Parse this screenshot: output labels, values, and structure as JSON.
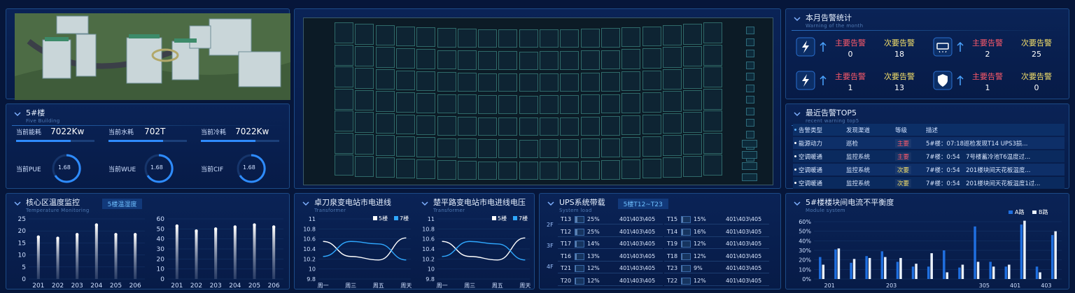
{
  "building": {
    "title": "5#楼",
    "subtitle": "Five Building",
    "energy": [
      {
        "label": "当前能耗",
        "value": "7022Kw"
      },
      {
        "label": "当前水耗",
        "value": "702T"
      },
      {
        "label": "当前冷耗",
        "value": "7022Kw"
      }
    ],
    "gauges": [
      {
        "label": "当前PUE",
        "value": "1.68"
      },
      {
        "label": "当前WUE",
        "value": "1.68"
      },
      {
        "label": "当前CIF",
        "value": "1.68"
      }
    ]
  },
  "alarm_month": {
    "title": "本月告警统计",
    "subtitle": "Warning of the month",
    "groups": [
      {
        "icon": "lightning-icon",
        "major_label": "主要告警",
        "major": "0",
        "minor_label": "次要告警",
        "minor": "18"
      },
      {
        "icon": "air-conditioner-icon",
        "major_label": "主要告警",
        "major": "2",
        "minor_label": "次要告警",
        "minor": "25"
      },
      {
        "icon": "lightning-icon",
        "major_label": "主要告警",
        "major": "1",
        "minor_label": "次要告警",
        "minor": "13"
      },
      {
        "icon": "shield-icon",
        "major_label": "主要告警",
        "major": "1",
        "minor_label": "次要告警",
        "minor": "0"
      }
    ]
  },
  "recent_alarms": {
    "title": "最近告警TOP5",
    "subtitle": "recent warning top5",
    "headers": [
      "告警类型",
      "发现渠道",
      "等级",
      "描述"
    ],
    "rows": [
      [
        "能源动力",
        "巡检",
        "主要",
        "5#楼：07:18巡检发现T14 UPS3损..."
      ],
      [
        "空调暖通",
        "监控系统",
        "主要",
        "7#楼：0:54　7号楼蓄冷池T6温度过..."
      ],
      [
        "空调暖通",
        "监控系统",
        "次要",
        "7#楼：0:54　201楼块间天花板温度..."
      ],
      [
        "空调暖通",
        "监控系统",
        "次要",
        "7#楼：0:54　201楼块间天花板温度1过..."
      ]
    ]
  },
  "temp_monitor": {
    "title": "核心区温度监控",
    "subtitle": "Temperature Monitoring",
    "tag": "5楼温湿度"
  },
  "transformer_a": {
    "title": "卓刀泉变电站市电进线",
    "subtitle": "Transformer",
    "legend": [
      "5楼",
      "7楼"
    ]
  },
  "transformer_b": {
    "title": "楚平路变电站市电进线电压",
    "subtitle": "Transformer",
    "legend": [
      "5楼",
      "7楼"
    ]
  },
  "ups": {
    "title": "UPS系统带载",
    "subtitle": "System load",
    "tag": "5楼T12~T23",
    "floors": [
      "2F",
      "3F",
      "4F"
    ],
    "left": [
      {
        "name": "T13",
        "pct": "25%",
        "v": "401\\403\\405"
      },
      {
        "name": "T12",
        "pct": "25%",
        "v": "401\\403\\405"
      },
      {
        "name": "T17",
        "pct": "14%",
        "v": "401\\403\\405"
      },
      {
        "name": "T16",
        "pct": "13%",
        "v": "401\\403\\405"
      },
      {
        "name": "T21",
        "pct": "12%",
        "v": "401\\403\\405"
      },
      {
        "name": "T20",
        "pct": "12%",
        "v": "401\\403\\405"
      }
    ],
    "right": [
      {
        "name": "T15",
        "pct": "15%",
        "v": "401\\403\\405"
      },
      {
        "name": "T14",
        "pct": "16%",
        "v": "401\\403\\405"
      },
      {
        "name": "T19",
        "pct": "12%",
        "v": "401\\403\\405"
      },
      {
        "name": "T18",
        "pct": "12%",
        "v": "401\\403\\405"
      },
      {
        "name": "T23",
        "pct": "9%",
        "v": "401\\403\\405"
      },
      {
        "name": "T22",
        "pct": "12%",
        "v": "401\\403\\405"
      }
    ]
  },
  "module_balance": {
    "title": "5#楼楼块间电流不平衡度",
    "subtitle": "Module system"
  },
  "chart_data": [
    {
      "type": "bar",
      "categories": [
        "201",
        "202",
        "203",
        "204",
        "205",
        "206"
      ],
      "values": [
        17.5,
        17,
        18.5,
        22.5,
        18.5,
        18.5
      ],
      "ylim": [
        0,
        25
      ],
      "yticks": [
        0,
        5,
        10,
        15,
        20,
        25
      ]
    },
    {
      "type": "bar",
      "categories": [
        "201",
        "202",
        "203",
        "204",
        "205",
        "206"
      ],
      "values": [
        53,
        48,
        50,
        52,
        54,
        52
      ],
      "ylim": [
        0,
        60
      ],
      "yticks": [
        0,
        10,
        20,
        30,
        40,
        50,
        60
      ]
    },
    {
      "type": "line",
      "x": [
        "周一",
        "周三",
        "周五",
        "周天"
      ],
      "ylim": [
        9.8,
        11
      ],
      "yticks": [
        9.8,
        10,
        10.2,
        10.4,
        10.6,
        10.8,
        11
      ],
      "series": [
        {
          "name": "5楼",
          "values": [
            10.55,
            10.25,
            10.18,
            10.62
          ]
        },
        {
          "name": "7楼",
          "values": [
            10.25,
            10.55,
            10.5,
            10.18
          ]
        }
      ]
    },
    {
      "type": "line",
      "x": [
        "周一",
        "周三",
        "周五",
        "周天"
      ],
      "ylim": [
        9.8,
        11
      ],
      "yticks": [
        9.8,
        10,
        10.2,
        10.4,
        10.6,
        10.8,
        11
      ],
      "series": [
        {
          "name": "5楼",
          "values": [
            10.55,
            10.25,
            10.18,
            10.62
          ]
        },
        {
          "name": "7楼",
          "values": [
            10.25,
            10.55,
            10.5,
            10.18
          ]
        }
      ]
    },
    {
      "type": "bar",
      "categories": [
        "201",
        "",
        "203",
        "",
        "",
        "305",
        "401",
        "403"
      ],
      "legend": [
        "A路",
        "B路"
      ],
      "ylim": [
        0,
        60
      ],
      "yticks": [
        "0%",
        "10%",
        "20%",
        "30%",
        "40%",
        "50%",
        "60%"
      ],
      "series": [
        {
          "name": "A路",
          "values": [
            23,
            31,
            17,
            24,
            29,
            18,
            13,
            13,
            30,
            12,
            55,
            18,
            13,
            57,
            13,
            46
          ]
        },
        {
          "name": "B路",
          "values": [
            15,
            32,
            21,
            22,
            23,
            22,
            16,
            27,
            7,
            15,
            18,
            13,
            15,
            61,
            7,
            50
          ]
        }
      ]
    }
  ]
}
